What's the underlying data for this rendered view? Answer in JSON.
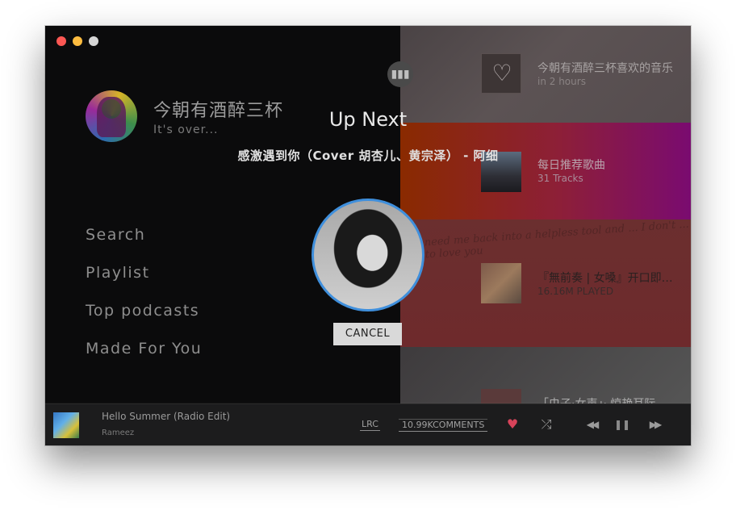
{
  "profile": {
    "name": "今朝有酒醉三杯",
    "status": "It's over..."
  },
  "menu": {
    "items": [
      {
        "label": "Search"
      },
      {
        "label": "Playlist"
      },
      {
        "label": "Top podcasts"
      },
      {
        "label": "Made For You"
      }
    ]
  },
  "cards": [
    {
      "title": "今朝有酒醉三杯喜欢的音乐",
      "subtitle": "in 2 hours",
      "icon": "heart-icon"
    },
    {
      "title": "每日推荐歌曲",
      "subtitle": "31 Tracks"
    },
    {
      "title": "『無前奏 | 女嗓』开口即跪 ...",
      "subtitle": "16.16M PLAYED",
      "scribble": "need me back into a helpless tool and ... I don't ... to love you"
    },
    {
      "title": "「虫子·女声」· 惊艳耳际"
    }
  ],
  "up_next": {
    "title": "Up Next",
    "song": "感激遇到你（Cover 胡杏儿、黄宗泽） - 阿细",
    "cancel_label": "CANCEL",
    "ring_color": "#3f8fdc"
  },
  "player": {
    "track_title": "Hello Summer (Radio Edit)",
    "artist": "Rameez",
    "lrc_label": "LRC",
    "comments_label": "10.99KCOMMENTS",
    "liked": true,
    "like_color": "#d8435a"
  }
}
